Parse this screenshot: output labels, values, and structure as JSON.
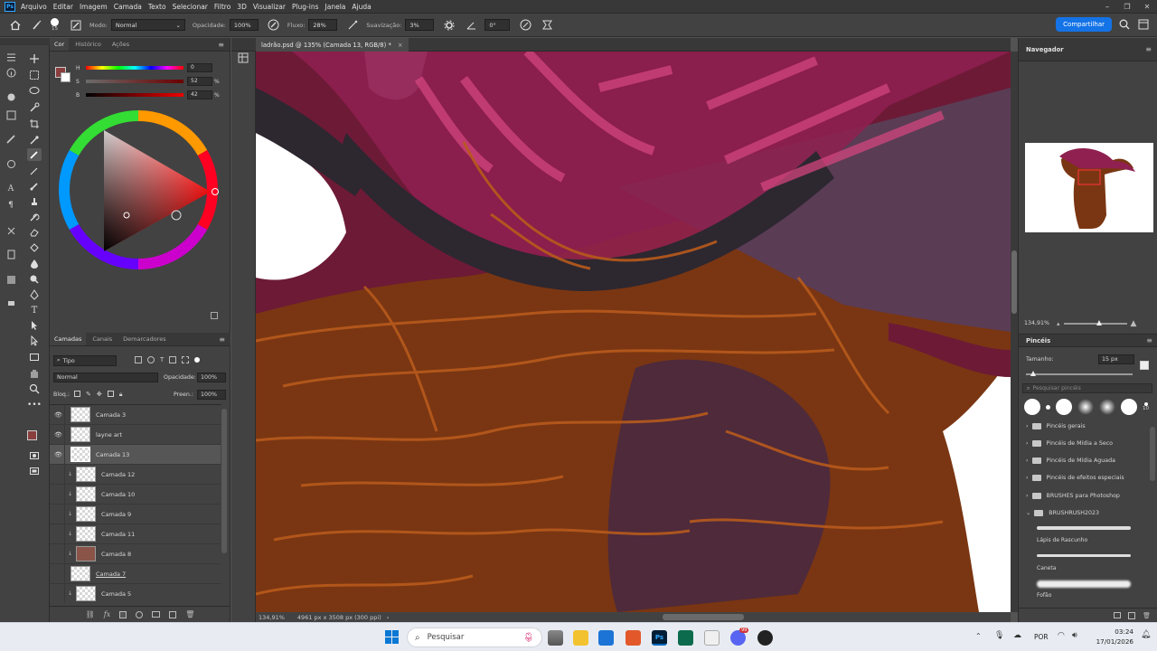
{
  "app": {
    "logo": "Ps"
  },
  "menu": [
    "Arquivo",
    "Editar",
    "Imagem",
    "Camada",
    "Texto",
    "Selecionar",
    "Filtro",
    "3D",
    "Visualizar",
    "Plug-ins",
    "Janela",
    "Ajuda"
  ],
  "options": {
    "brush_size": "15",
    "mode_label": "Modo:",
    "mode_value": "Normal",
    "opacity_label": "Opacidade:",
    "opacity_value": "100%",
    "flow_label": "Fluxo:",
    "flow_value": "28%",
    "smoothing_label": "Suavização:",
    "smoothing_value": "3%",
    "angle_value": "0°",
    "share_label": "Compartilhar"
  },
  "color_panel": {
    "tabs": [
      "Cor",
      "Histórico",
      "Ações"
    ],
    "h_label": "H",
    "h_value": "0",
    "s_label": "S",
    "s_value": "52",
    "s_unit": "%",
    "b_label": "B",
    "b_value": "42",
    "b_unit": "%",
    "foreground": "#8a3e3e"
  },
  "layers_panel": {
    "tabs": [
      "Camadas",
      "Canais",
      "Demarcadores"
    ],
    "filter_value": "Tipo",
    "blend_value": "Normal",
    "opacity_label": "Opacidade:",
    "opacity_value": "100%",
    "lock_label": "Bloq.:",
    "fill_label": "Preen.:",
    "fill_value": "100%",
    "layers": [
      {
        "name": "Camada 3",
        "visible": true
      },
      {
        "name": "layne art",
        "visible": true
      },
      {
        "name": "Camada 13",
        "visible": true,
        "selected": true
      },
      {
        "name": "Camada 12",
        "visible": false
      },
      {
        "name": "Camada 10",
        "visible": false
      },
      {
        "name": "Camada 9",
        "visible": false
      },
      {
        "name": "Camada 11",
        "visible": false
      },
      {
        "name": "Camada 8",
        "visible": false
      },
      {
        "name": "Camada 7",
        "visible": false
      },
      {
        "name": "Camada 5",
        "visible": false
      }
    ]
  },
  "document": {
    "tab_title": "ladrão.psd @ 135% (Camada 13, RGB/8) *",
    "status_zoom": "134,91%",
    "status_info": "4961 px x 3508 px (300 ppi)"
  },
  "navigator": {
    "title": "Navegador",
    "zoom": "134,91%"
  },
  "brushes_panel": {
    "title": "Pincéis",
    "size_label": "Tamanho:",
    "size_value": "15 px",
    "search_placeholder": "Pesquisar pincéis",
    "preset_size": "10",
    "folders": [
      "Pincéis gerais",
      "Pincéis de Mídia a Seco",
      "Pincéis de Mídia Aguada",
      "Pincéis de efeitos especiais",
      "BRUSHES para Photoshop",
      "BRUSHRUSH2023"
    ],
    "brushes": [
      "Lápis de Rascunho",
      "Caneta",
      "Fofão"
    ]
  },
  "taskbar": {
    "search_placeholder": "Pesquisar",
    "lang": "POR",
    "time": "03:24",
    "date": "17/01/2026",
    "discord_badge": "99"
  }
}
